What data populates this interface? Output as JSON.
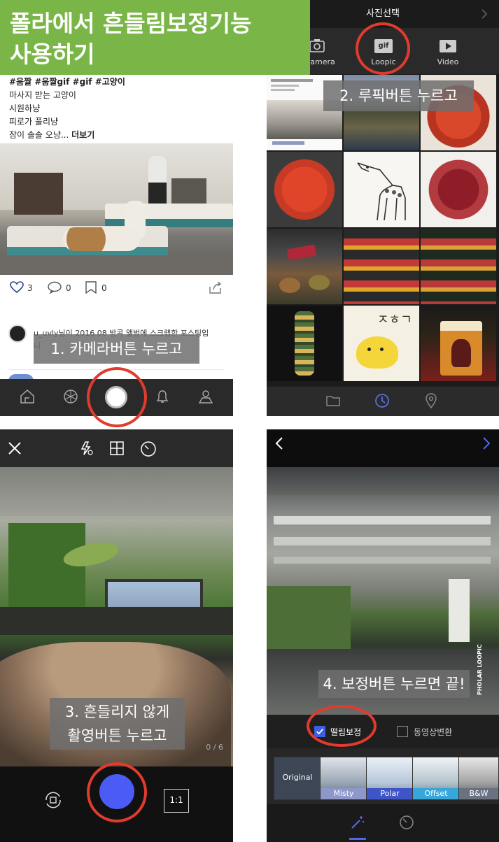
{
  "banner": {
    "line1": "폴라에서 흔들림보정기능",
    "line2": "사용하기"
  },
  "panel1": {
    "post": {
      "tags": "#움짤 #움짤gif #gif #고양이",
      "line1": "마사지 받는 고양이",
      "line2": "시원하냥",
      "line3": "피로가 풀리냥",
      "line4": "잠이 솔솔 오냥... ",
      "more": "더보기"
    },
    "likes": "3",
    "comments": "0",
    "bookmarks": "0",
    "comment_text": "u_uvly님이 2016.08 방콕 앨범에 스크랩한 포스팅입",
    "comment_text2": "니",
    "icons": [
      "home-icon",
      "explore-icon",
      "camera-button",
      "bell-icon",
      "profile-icon"
    ],
    "caption": "1. 카메라버튼 누르고"
  },
  "panel2": {
    "title": "사진선택",
    "tabs": [
      {
        "label": "amera",
        "icon": "camera-icon"
      },
      {
        "label": "Loopic",
        "icon": "gif-icon",
        "badge": "gif"
      },
      {
        "label": "Video",
        "icon": "video-icon"
      }
    ],
    "caption": "2. 루픽버튼 누르고",
    "bottom_icons": [
      "folder-icon",
      "clock-icon",
      "location-icon"
    ],
    "doodle_text": "ㅈㅎㄱ"
  },
  "panel3": {
    "count": "0 / 6",
    "ratio": "1:1",
    "caption_line1": "3. 흔들리지 않게",
    "caption_line2": "촬영버튼 누르고",
    "top_icons": [
      "close-icon",
      "flash-off-icon",
      "grid-icon",
      "timer-icon"
    ],
    "accent": "#4a5cf5"
  },
  "panel4": {
    "watermark": "PHOLAR LOOPIC",
    "caption": "4. 보정버튼 누르면 끝!",
    "option_stabilize": "떨림보정",
    "option_convert": "동영상변환",
    "filters": [
      "Original",
      "Misty",
      "Polar",
      "Offset",
      "B&W"
    ],
    "accent": "#3a5fe0"
  }
}
